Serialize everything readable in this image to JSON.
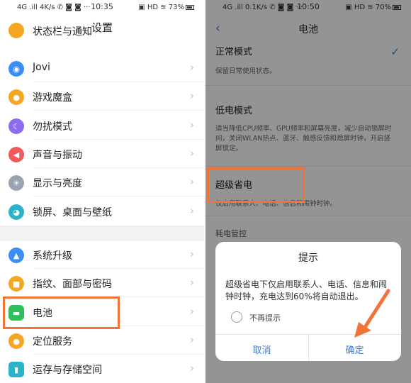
{
  "left": {
    "status": {
      "left": "4G .ill 4K/s ✆ ◙ ◙ ···",
      "time": "10:35",
      "right": "▣ HD ≋ 73%"
    },
    "title": "设置",
    "items": [
      {
        "label": "状态栏与通知",
        "icon": "notification-icon",
        "color": "#f5a623"
      },
      {
        "label": "Jovi",
        "icon": "jovi-icon",
        "color": "#3a8ef6"
      },
      {
        "label": "游戏魔盒",
        "icon": "game-icon",
        "color": "#f5a623"
      },
      {
        "label": "勿扰模式",
        "icon": "moon-icon",
        "color": "#8e6cf0"
      },
      {
        "label": "声音与振动",
        "icon": "speaker-icon",
        "color": "#f05a5a"
      },
      {
        "label": "显示与亮度",
        "icon": "sun-icon",
        "color": "#9aa4b1"
      },
      {
        "label": "锁屏、桌面与壁纸",
        "icon": "palette-icon",
        "color": "#2bb4c9"
      },
      {
        "label": "系统升级",
        "icon": "upgrade-icon",
        "color": "#3a8ef6"
      },
      {
        "label": "指纹、面部与密码",
        "icon": "lock-icon",
        "color": "#f5a623"
      },
      {
        "label": "电池",
        "icon": "battery-icon",
        "color": "#2fbf5c"
      },
      {
        "label": "定位服务",
        "icon": "location-icon",
        "color": "#f5a623"
      },
      {
        "label": "运存与存储空间",
        "icon": "storage-icon",
        "color": "#2bb4c9"
      }
    ]
  },
  "right": {
    "status": {
      "left": "4G .ill 0.1K/s ✆ ◙ ◙ ···",
      "time": "10:50",
      "right": "▣ HD ≋ 70%"
    },
    "title": "电池",
    "modes": [
      {
        "title": "正常模式",
        "desc": "保留日常使用状态。"
      },
      {
        "title": "低电模式",
        "desc": "适当降低CPU频率、GPU频率和屏幕亮度，减少自动锁屏时间，关闭WLAN热点、蓝牙、触感反馈和熄屏时钟，开启竖屏锁定。"
      },
      {
        "title": "超级省电",
        "desc": "仅启用联系人、电话、信息和闹钟时钟。"
      }
    ],
    "section": "耗电管控",
    "dialog": {
      "title": "提示",
      "message": "超级省电下仅启用联系人、电话、信息和闹钟时钟，充电达到60%将自动退出。",
      "checkbox_label": "不再提示",
      "cancel": "取消",
      "confirm": "确定"
    }
  },
  "colors": {
    "accent": "#3a7bd5",
    "highlight": "#f07338"
  }
}
